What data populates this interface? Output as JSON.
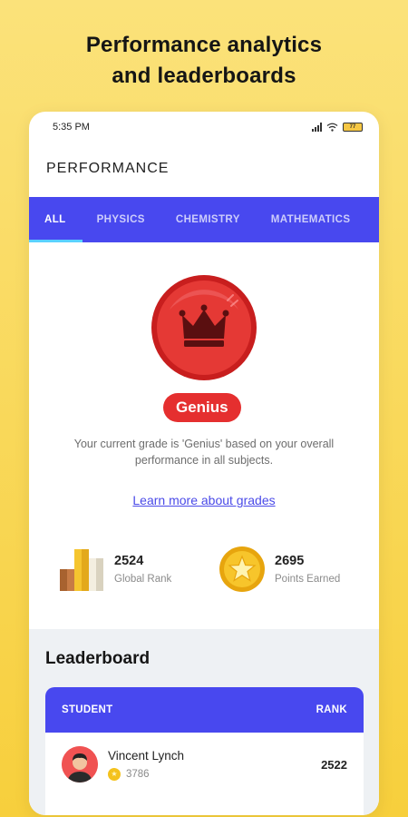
{
  "promo": {
    "line1": "Performance analytics",
    "line2": "and leaderboards"
  },
  "status_bar": {
    "time": "5:35 PM",
    "battery": "77"
  },
  "header": {
    "title": "PERFORMANCE"
  },
  "tabs": [
    {
      "label": "ALL",
      "active": true
    },
    {
      "label": "PHYSICS",
      "active": false
    },
    {
      "label": "CHEMISTRY",
      "active": false
    },
    {
      "label": "MATHEMATICS",
      "active": false
    }
  ],
  "grade": {
    "icon": "crown-icon",
    "name": "Genius",
    "description": "Your current grade is 'Genius' based on your overall performance in all subjects.",
    "link_text": "Learn more about grades"
  },
  "stats": {
    "global_rank": {
      "value": "2524",
      "label": "Global Rank",
      "icon": "podium-icon"
    },
    "points": {
      "value": "2695",
      "label": "Points Earned",
      "icon": "star-coin-icon"
    }
  },
  "leaderboard": {
    "title": "Leaderboard",
    "columns": {
      "student": "STUDENT",
      "rank": "RANK"
    },
    "rows": [
      {
        "name": "Vincent Lynch",
        "points": "3786",
        "rank": "2522"
      }
    ]
  },
  "colors": {
    "background": "#f7cf3c",
    "accent": "#4848ef",
    "tab_indicator": "#5ad1ff",
    "grade_red": "#e52f2f",
    "link": "#4a4ae8"
  }
}
